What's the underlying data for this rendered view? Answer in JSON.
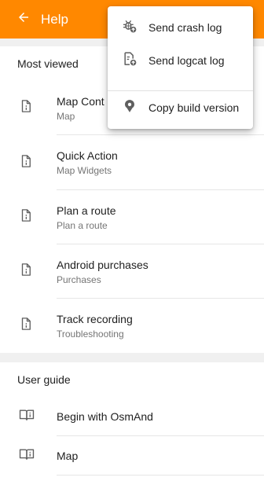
{
  "appbar": {
    "title": "Help",
    "back_icon": "arrow-left-icon",
    "color": "#ff8800"
  },
  "most_viewed": {
    "header": "Most viewed",
    "items": [
      {
        "title": "Map Cont",
        "subtitle": "Map",
        "icon": "article-icon"
      },
      {
        "title": "Quick Action",
        "subtitle": "Map Widgets",
        "icon": "article-icon"
      },
      {
        "title": "Plan a route",
        "subtitle": "Plan a route",
        "icon": "article-icon"
      },
      {
        "title": "Android purchases",
        "subtitle": "Purchases",
        "icon": "article-icon"
      },
      {
        "title": "Track recording",
        "subtitle": "Troubleshooting",
        "icon": "article-icon"
      }
    ]
  },
  "user_guide": {
    "header": "User guide",
    "items": [
      {
        "title": "Begin with OsmAnd",
        "icon": "book-info-icon"
      },
      {
        "title": "Map",
        "icon": "book-info-icon"
      }
    ]
  },
  "overflow_menu": {
    "items": [
      {
        "label": "Send crash log",
        "icon": "bug-upload-icon"
      },
      {
        "label": "Send logcat log",
        "icon": "file-upload-icon"
      },
      {
        "label": "Copy build version",
        "icon": "osmand-pin-icon"
      }
    ]
  }
}
